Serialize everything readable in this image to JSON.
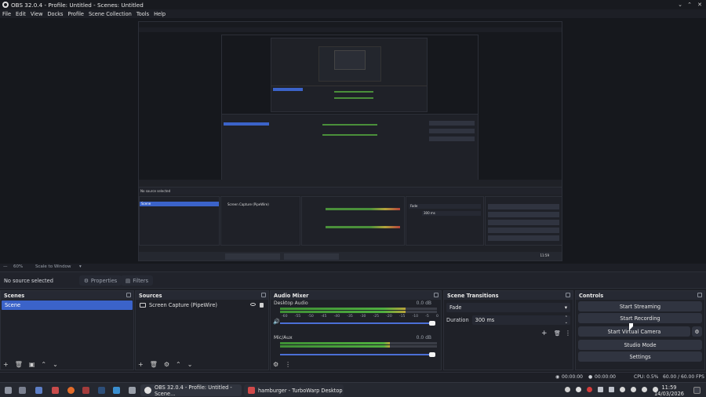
{
  "window": {
    "title": "OBS 32.0.4 - Profile: Untitled - Scenes: Untitled"
  },
  "menu": [
    "File",
    "Edit",
    "View",
    "Docks",
    "Profile",
    "Scene Collection",
    "Tools",
    "Help"
  ],
  "zoombar": {
    "zoom": "60%",
    "mode": "Scale to Window"
  },
  "source_bar": {
    "no_source": "No source selected",
    "properties": "Properties",
    "filters": "Filters"
  },
  "docks": {
    "scenes": {
      "title": "Scenes",
      "items": [
        "Scene"
      ]
    },
    "sources": {
      "title": "Sources",
      "items": [
        "Screen Capture (PipeWire)"
      ]
    },
    "mixer": {
      "title": "Audio Mixer",
      "channels": [
        {
          "name": "Desktop Audio",
          "db": "0.0 dB",
          "level": 0.8,
          "fader": 1.0
        },
        {
          "name": "Mic/Aux",
          "db": "0.0 dB",
          "level": 0.7,
          "fader": 1.0
        }
      ],
      "scale": [
        "-60",
        "-55",
        "-50",
        "-45",
        "-40",
        "-35",
        "-30",
        "-25",
        "-20",
        "-15",
        "-10",
        "-5",
        "0"
      ]
    },
    "transitions": {
      "title": "Scene Transitions",
      "type": "Fade",
      "duration_label": "Duration",
      "duration": "300 ms"
    },
    "controls": {
      "title": "Controls",
      "buttons": [
        "Start Streaming",
        "Start Recording",
        "Start Virtual Camera",
        "Studio Mode",
        "Settings"
      ]
    }
  },
  "status": {
    "rec_time": "00:00:00",
    "stream_time": "00:00:00",
    "cpu": "CPU: 0.5%",
    "fps": "60.00 / 60.00 FPS"
  },
  "taskbar": {
    "apps": [
      {
        "label": "OBS 32.0.4 - Profile: Untitled - Scene..."
      },
      {
        "label": "hamburger - TurboWarp Desktop"
      }
    ],
    "time": "11:59",
    "date": "14/03/2026"
  },
  "nested": {
    "no_source": "No source selected",
    "scene": "Scene",
    "source": "Screen Capture (PipeWire)",
    "fade": "Fade",
    "duration": "300 ms",
    "time": "11:59"
  }
}
